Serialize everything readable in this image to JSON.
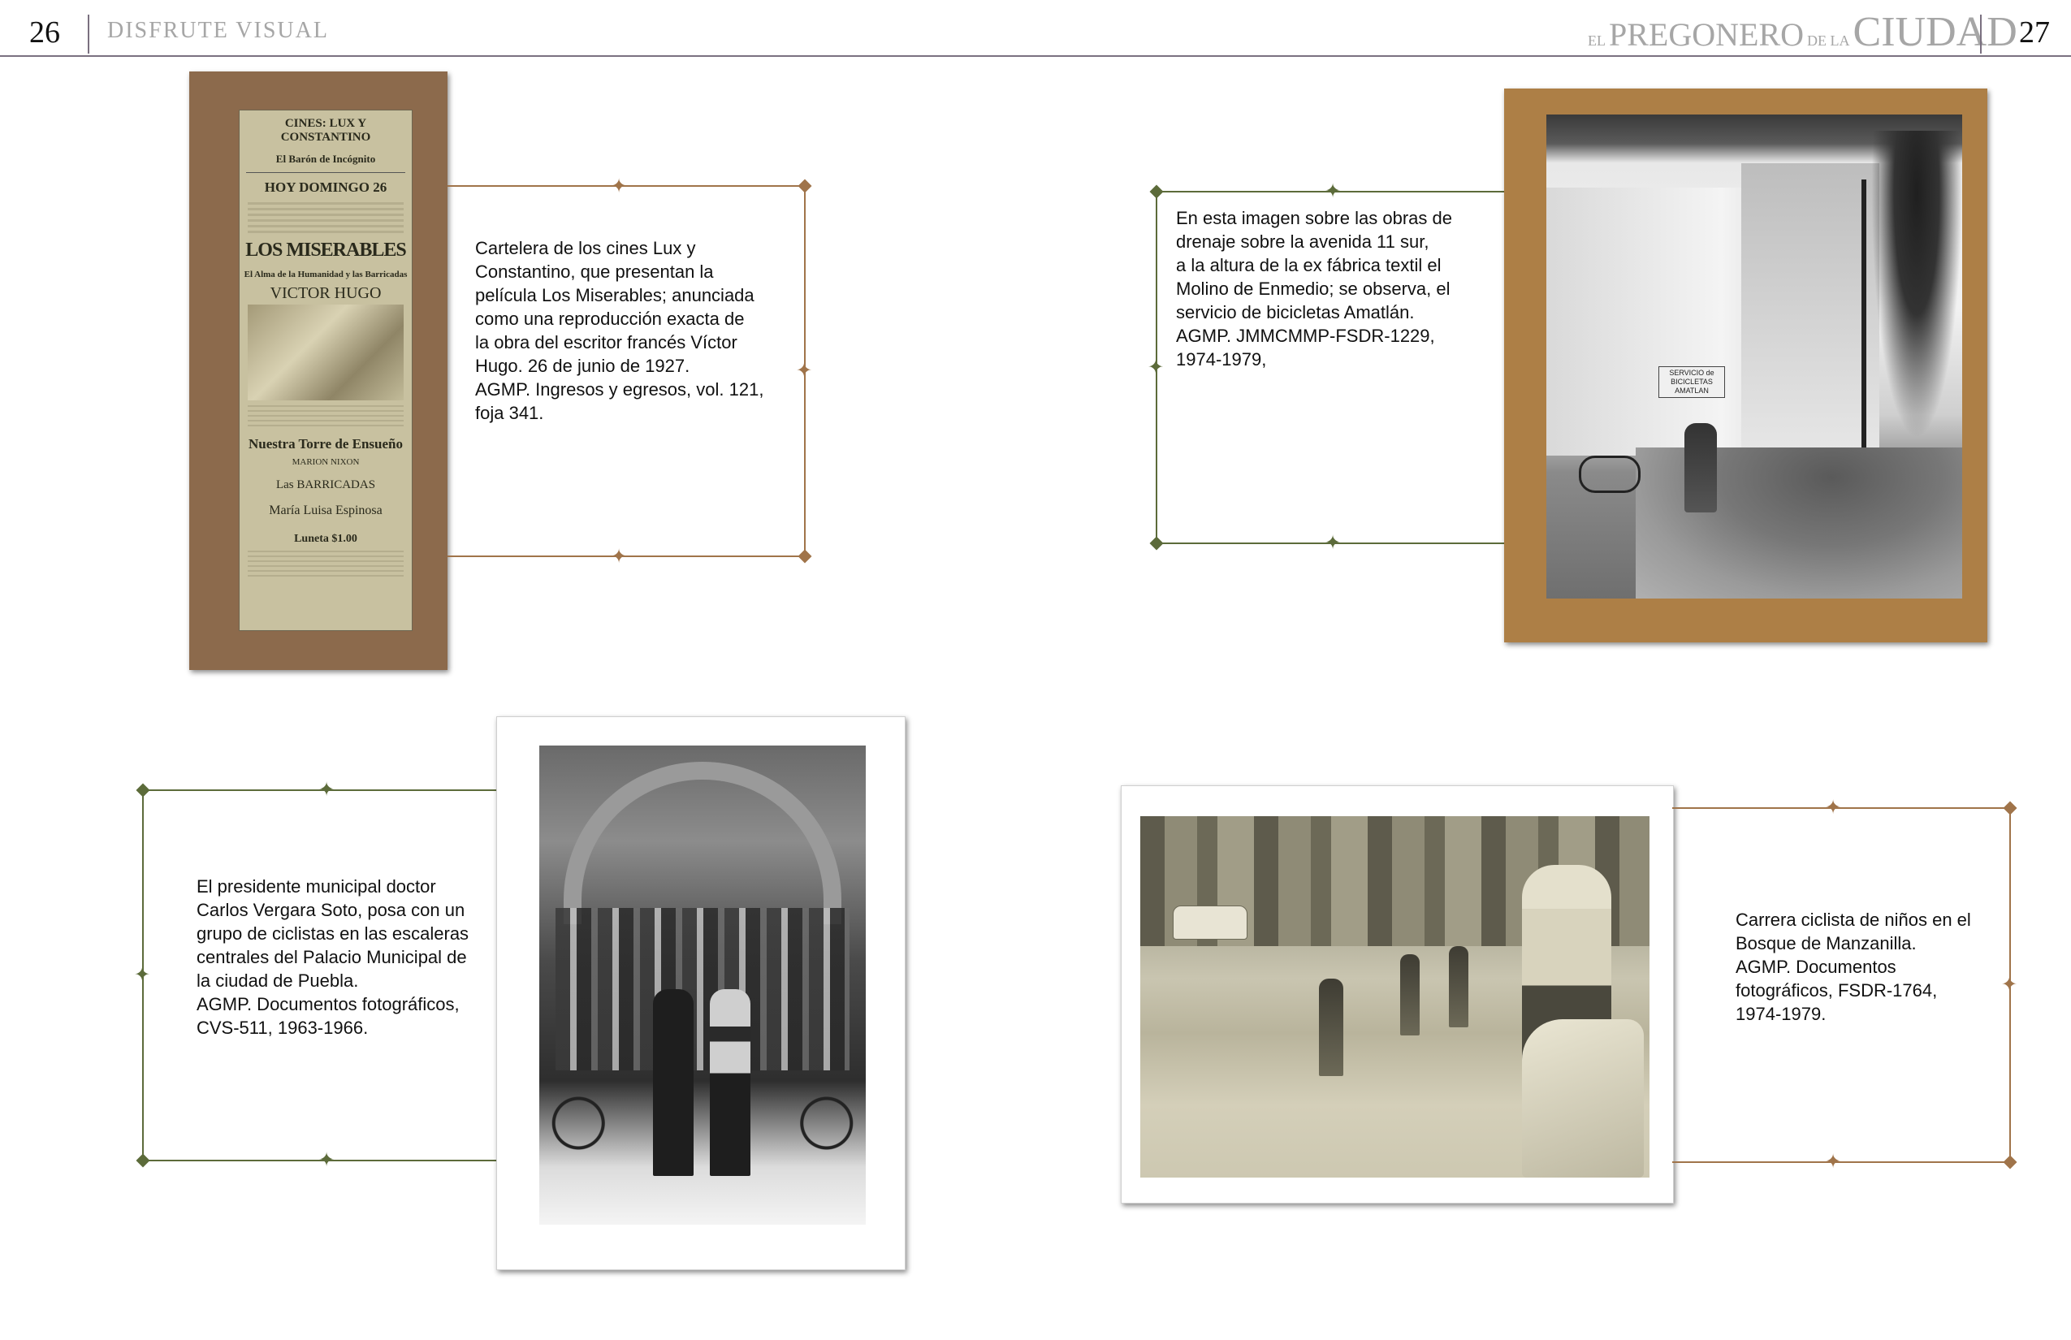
{
  "header": {
    "left_page_number": "26",
    "left_section_title": "DISFRUTE VISUAL",
    "right_page_number": "27",
    "brand": {
      "el": "EL",
      "pregonero": "PREGONERO",
      "de_la": "DE LA",
      "ciudad": "CIUDAD"
    }
  },
  "poster": {
    "title": "CINES: LUX Y CONSTANTINO",
    "subtitle": "El Barón de Incógnito",
    "date_line": "HOY DOMINGO 26",
    "film": "LOS MISERABLES",
    "tagline": "El Alma de la Humanidad y las Barricadas",
    "author": "VICTOR HUGO",
    "second_film": "Nuestra Torre de Ensueño",
    "second_star": "MARION NIXON",
    "third_film": "Las BARRICADAS",
    "actress": "María Luisa Espinosa",
    "price": "Luneta $1.00"
  },
  "captions": {
    "poster": "Cartelera de los cines Lux y\nConstantino, que presentan la\npelícula Los Miserables; anunciada\ncomo una reproducción exacta de\nla obra del escritor francés Víctor\nHugo. 26 de junio de 1927.\nAGMP. Ingresos y egresos, vol. 121,\nfoja 341.",
    "drainage": "En esta imagen sobre las obras de\ndrenaje sobre la avenida 11 sur,\na la altura de la ex fábrica textil el\nMolino de Enmedio; se observa, el\nservicio de bicicletas Amatlán.\nAGMP. JMMCMMP-FSDR-1229,\n1974-1979,",
    "cyclists": "El presidente municipal doctor\nCarlos Vergara Soto, posa con un\ngrupo de ciclistas en las escaleras\ncentrales del Palacio Municipal de\nla ciudad de Puebla.\nAGMP. Documentos fotográficos,\nCVS-511, 1963-1966.",
    "race": "Carrera ciclista de niños en el\nBosque de Manzanilla.\nAGMP. Documentos\nfotográficos, FSDR-1764,\n1974-1979."
  },
  "shop_sign": "SERVICIO de BICICLETAS AMATLAN",
  "colors": {
    "brown_line": "#a0744a",
    "green_line": "#5c6b3a",
    "poster_mat": "#8c6a4c",
    "drainage_mat": "#ad7f46",
    "header_rule": "#7a7080",
    "header_text": "#a6a6a6"
  }
}
